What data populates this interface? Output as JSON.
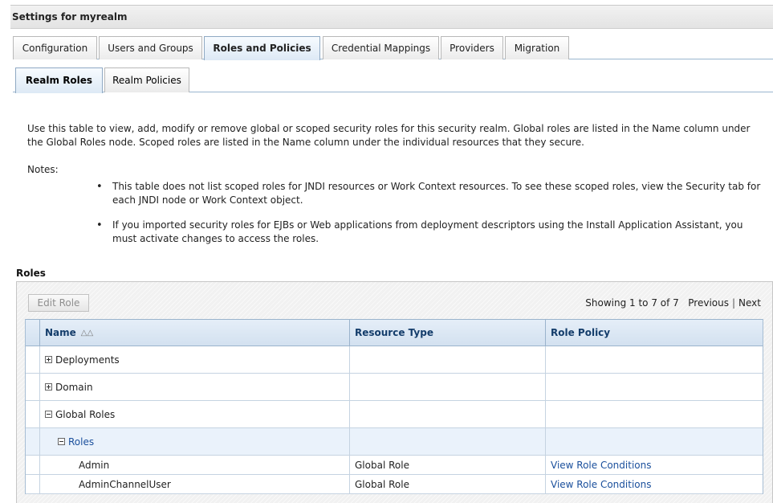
{
  "header": {
    "title": "Settings for myrealm"
  },
  "tabs": [
    {
      "label": "Configuration"
    },
    {
      "label": "Users and Groups"
    },
    {
      "label": "Roles and Policies"
    },
    {
      "label": "Credential Mappings"
    },
    {
      "label": "Providers"
    },
    {
      "label": "Migration"
    }
  ],
  "active_tab": "Roles and Policies",
  "subtabs": [
    {
      "label": "Realm Roles"
    },
    {
      "label": "Realm Policies"
    }
  ],
  "active_subtab": "Realm Roles",
  "description": "Use this table to view, add, modify or remove global or scoped security roles for this security realm. Global roles are listed in the Name column under the Global Roles node. Scoped roles are listed in the Name column under the individual resources that they secure.",
  "notes": {
    "label": "Notes:",
    "items": [
      "This table does not list scoped roles for JNDI resources or Work Context resources. To see these scoped roles, view the Security tab for each JNDI node or Work Context object.",
      "If you imported security roles for EJBs or Web applications from deployment descriptors using the Install Application Assistant, you must activate changes to access the roles."
    ]
  },
  "roles": {
    "heading": "Roles",
    "edit_button": "Edit Role",
    "pager": {
      "showing": "Showing 1 to 7 of 7",
      "previous": "Previous",
      "separator": "|",
      "next": "Next"
    },
    "columns": {
      "name": "Name",
      "resource_type": "Resource Type",
      "role_policy": "Role Policy"
    },
    "rows": [
      {
        "name": "Deployments",
        "resource_type": "",
        "role_policy": ""
      },
      {
        "name": "Domain",
        "resource_type": "",
        "role_policy": ""
      },
      {
        "name": "Global Roles",
        "resource_type": "",
        "role_policy": ""
      },
      {
        "name": "Roles",
        "resource_type": "",
        "role_policy": ""
      },
      {
        "name": "Admin",
        "resource_type": "Global Role",
        "role_policy": "View Role Conditions"
      },
      {
        "name": "AdminChannelUser",
        "resource_type": "Global Role",
        "role_policy": "View Role Conditions"
      }
    ]
  },
  "colors": {
    "link": "#1a4f9c",
    "header_text": "#143d6b",
    "tab_border": "#9ab6cf"
  }
}
